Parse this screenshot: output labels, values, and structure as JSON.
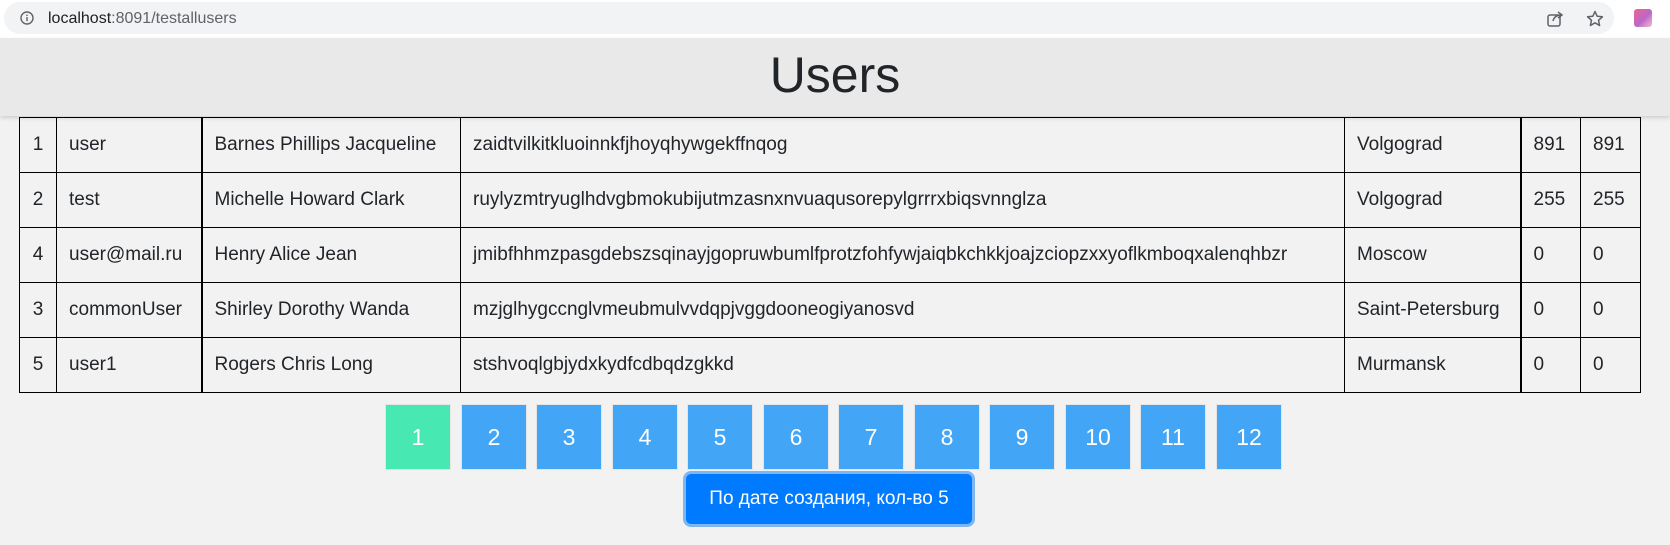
{
  "browser": {
    "url_host": "localhost",
    "url_rest": ":8091/testallusers"
  },
  "page": {
    "title": "Users"
  },
  "users": [
    {
      "id": "1",
      "login": "user",
      "name": "Barnes Phillips Jacqueline",
      "token": "zaidtvilkitkluoinnkfjhoyqhywgekffnqog",
      "city": "Volgograd",
      "a": "891",
      "b": "891"
    },
    {
      "id": "2",
      "login": "test",
      "name": "Michelle Howard Clark",
      "token": "ruylyzmtryuglhdvgbmokubijutmzasnxnvuaqusorepylgrrrxbiqsvnnglza",
      "city": "Volgograd",
      "a": "255",
      "b": "255"
    },
    {
      "id": "4",
      "login": "user@mail.ru",
      "name": "Henry Alice Jean",
      "token": "jmibfhhmzpasgdebszsqinayjgopruwbumlfprotzfohfywjaiqbkchkkjoajzciopzxxyoflkmboqxalenqhbzr",
      "city": "Moscow",
      "a": "0",
      "b": "0"
    },
    {
      "id": "3",
      "login": "commonUser",
      "name": "Shirley Dorothy Wanda",
      "token": "mzjglhygccnglvmeubmulvvdqpjvggdooneogiyanosvd",
      "city": "Saint-Petersburg",
      "a": "0",
      "b": "0"
    },
    {
      "id": "5",
      "login": "user1",
      "name": "Rogers Chris Long",
      "token": "stshvoqlgbjydxkydfcdbqdzgkkd",
      "city": "Murmansk",
      "a": "0",
      "b": "0"
    }
  ],
  "pagination": {
    "current": "1",
    "pages": [
      "1",
      "2",
      "3",
      "4",
      "5",
      "6",
      "7",
      "8",
      "9",
      "10",
      "11",
      "12"
    ]
  },
  "sort_button": {
    "label": "По дате создания, кол-во 5"
  },
  "colors": {
    "page_active": "#47e8b2",
    "page_default": "#42a5f5",
    "sort_button": "#007bff",
    "header_bg": "#e9e9e9",
    "body_bg": "#f2f2f2"
  },
  "icons": {
    "address": "info-icon",
    "share": "share-icon",
    "bookmark": "star-icon",
    "extension": "extension-icon"
  }
}
